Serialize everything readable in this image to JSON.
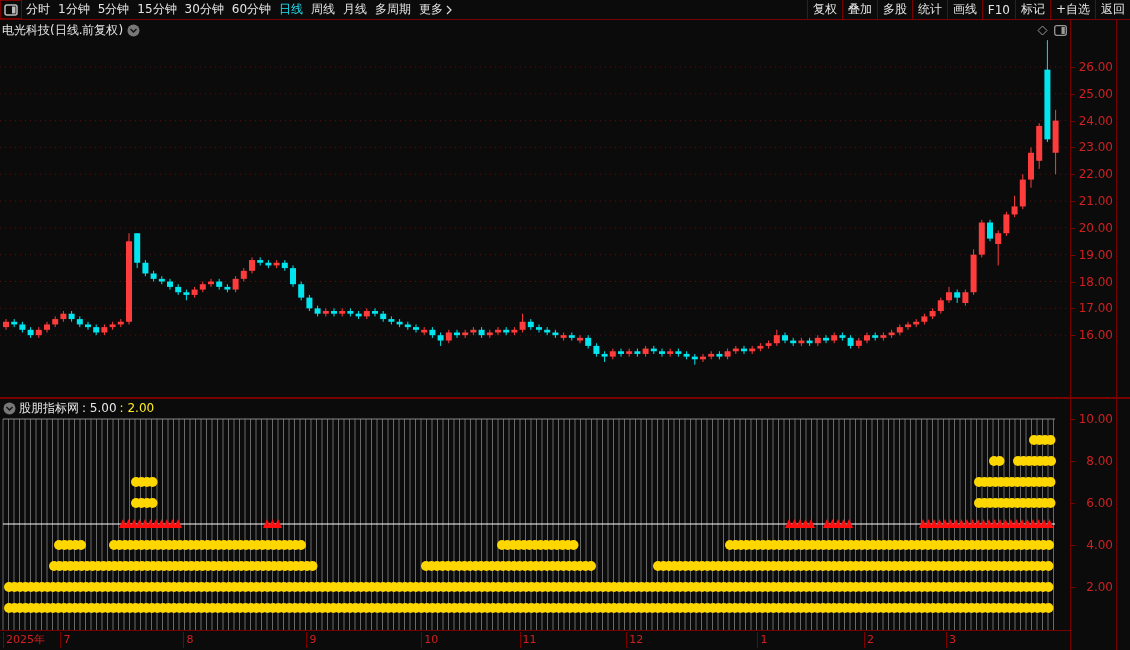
{
  "toolbar": {
    "periods": [
      {
        "label": "分时",
        "selected": false
      },
      {
        "label": "1分钟",
        "selected": false
      },
      {
        "label": "5分钟",
        "selected": false
      },
      {
        "label": "15分钟",
        "selected": false
      },
      {
        "label": "30分钟",
        "selected": false
      },
      {
        "label": "60分钟",
        "selected": false
      },
      {
        "label": "日线",
        "selected": true
      },
      {
        "label": "周线",
        "selected": false
      },
      {
        "label": "月线",
        "selected": false
      },
      {
        "label": "多周期",
        "selected": false
      },
      {
        "label": "更多",
        "selected": false
      }
    ],
    "buttons": [
      "复权",
      "叠加",
      "多股",
      "统计",
      "画线",
      "F10",
      "标记",
      "+自选",
      "返回"
    ]
  },
  "chart": {
    "title": "电光科技(日线.前复权)",
    "chart_data": {
      "type": "candlestick",
      "grid": true,
      "ylim": [
        4.3,
        27.75
      ],
      "yticks": [
        {
          "value": 26,
          "label": "26.00"
        },
        {
          "value": 25,
          "label": "25.00"
        },
        {
          "value": 24,
          "label": "24.00"
        },
        {
          "value": 23,
          "label": "23.00"
        },
        {
          "value": 22,
          "label": "22.00"
        },
        {
          "value": 21,
          "label": "21.00"
        },
        {
          "value": 20,
          "label": "20.00"
        },
        {
          "value": 19,
          "label": "19.00"
        },
        {
          "value": 18,
          "label": "18.00"
        },
        {
          "value": 17,
          "label": "17.00"
        },
        {
          "value": 16,
          "label": "16.00"
        }
      ],
      "ohlc": [
        [
          16.3,
          16.6,
          16.2,
          16.5
        ],
        [
          16.5,
          16.6,
          16.3,
          16.4
        ],
        [
          16.4,
          16.5,
          16.1,
          16.2
        ],
        [
          16.2,
          16.3,
          15.9,
          16.0
        ],
        [
          16.0,
          16.3,
          15.9,
          16.2
        ],
        [
          16.2,
          16.5,
          16.1,
          16.4
        ],
        [
          16.4,
          16.7,
          16.3,
          16.6
        ],
        [
          16.6,
          16.9,
          16.5,
          16.8
        ],
        [
          16.8,
          16.9,
          16.5,
          16.6
        ],
        [
          16.6,
          16.7,
          16.3,
          16.4
        ],
        [
          16.4,
          16.5,
          16.2,
          16.3
        ],
        [
          16.3,
          16.4,
          16.0,
          16.1
        ],
        [
          16.1,
          16.4,
          16.0,
          16.3
        ],
        [
          16.3,
          16.5,
          16.2,
          16.4
        ],
        [
          16.4,
          16.6,
          16.3,
          16.5
        ],
        [
          16.5,
          19.8,
          16.4,
          19.5
        ],
        [
          19.8,
          19.8,
          18.5,
          18.7
        ],
        [
          18.7,
          18.8,
          18.2,
          18.3
        ],
        [
          18.3,
          18.4,
          18.0,
          18.1
        ],
        [
          18.1,
          18.2,
          17.9,
          18.0
        ],
        [
          18.0,
          18.1,
          17.7,
          17.8
        ],
        [
          17.8,
          17.9,
          17.5,
          17.6
        ],
        [
          17.6,
          17.7,
          17.3,
          17.5
        ],
        [
          17.5,
          17.8,
          17.4,
          17.7
        ],
        [
          17.7,
          18.0,
          17.6,
          17.9
        ],
        [
          17.9,
          18.1,
          17.8,
          18.0
        ],
        [
          18.0,
          18.1,
          17.7,
          17.8
        ],
        [
          17.8,
          17.9,
          17.6,
          17.7
        ],
        [
          17.7,
          18.2,
          17.6,
          18.1
        ],
        [
          18.1,
          18.5,
          18.0,
          18.4
        ],
        [
          18.4,
          18.9,
          18.3,
          18.8
        ],
        [
          18.8,
          18.9,
          18.6,
          18.7
        ],
        [
          18.7,
          18.8,
          18.5,
          18.6
        ],
        [
          18.6,
          18.8,
          18.5,
          18.7
        ],
        [
          18.7,
          18.8,
          18.4,
          18.5
        ],
        [
          18.5,
          18.6,
          17.8,
          17.9
        ],
        [
          17.9,
          18.0,
          17.3,
          17.4
        ],
        [
          17.4,
          17.5,
          16.9,
          17.0
        ],
        [
          17.0,
          17.1,
          16.7,
          16.8
        ],
        [
          16.8,
          17.0,
          16.7,
          16.9
        ],
        [
          16.9,
          17.0,
          16.7,
          16.8
        ],
        [
          16.8,
          17.0,
          16.7,
          16.9
        ],
        [
          16.9,
          17.0,
          16.7,
          16.8
        ],
        [
          16.8,
          16.9,
          16.6,
          16.7
        ],
        [
          16.7,
          17.0,
          16.6,
          16.9
        ],
        [
          16.9,
          17.0,
          16.7,
          16.8
        ],
        [
          16.8,
          16.9,
          16.5,
          16.6
        ],
        [
          16.6,
          16.7,
          16.4,
          16.5
        ],
        [
          16.5,
          16.6,
          16.3,
          16.4
        ],
        [
          16.4,
          16.5,
          16.2,
          16.3
        ],
        [
          16.3,
          16.4,
          16.1,
          16.2
        ],
        [
          16.1,
          16.3,
          16.0,
          16.2
        ],
        [
          16.2,
          16.3,
          15.9,
          16.0
        ],
        [
          16.0,
          16.1,
          15.6,
          15.8
        ],
        [
          15.8,
          16.2,
          15.7,
          16.1
        ],
        [
          16.1,
          16.2,
          15.9,
          16.0
        ],
        [
          16.0,
          16.2,
          15.9,
          16.1
        ],
        [
          16.1,
          16.3,
          16.0,
          16.2
        ],
        [
          16.2,
          16.3,
          15.9,
          16.0
        ],
        [
          16.0,
          16.2,
          15.9,
          16.1
        ],
        [
          16.1,
          16.3,
          16.0,
          16.2
        ],
        [
          16.2,
          16.3,
          16.0,
          16.1
        ],
        [
          16.1,
          16.3,
          16.0,
          16.2
        ],
        [
          16.2,
          16.8,
          16.1,
          16.5
        ],
        [
          16.5,
          16.6,
          16.2,
          16.3
        ],
        [
          16.3,
          16.4,
          16.1,
          16.2
        ],
        [
          16.2,
          16.3,
          16.0,
          16.1
        ],
        [
          16.1,
          16.2,
          15.9,
          16.0
        ],
        [
          15.9,
          16.1,
          15.8,
          16.0
        ],
        [
          16.0,
          16.1,
          15.8,
          15.9
        ],
        [
          15.8,
          16.0,
          15.7,
          15.9
        ],
        [
          15.9,
          16.0,
          15.5,
          15.6
        ],
        [
          15.6,
          15.7,
          15.2,
          15.3
        ],
        [
          15.3,
          15.4,
          15.0,
          15.2
        ],
        [
          15.2,
          15.5,
          15.1,
          15.4
        ],
        [
          15.4,
          15.5,
          15.2,
          15.3
        ],
        [
          15.3,
          15.5,
          15.2,
          15.4
        ],
        [
          15.4,
          15.5,
          15.2,
          15.3
        ],
        [
          15.3,
          15.6,
          15.2,
          15.5
        ],
        [
          15.5,
          15.6,
          15.3,
          15.4
        ],
        [
          15.4,
          15.5,
          15.2,
          15.3
        ],
        [
          15.3,
          15.5,
          15.2,
          15.4
        ],
        [
          15.4,
          15.5,
          15.2,
          15.3
        ],
        [
          15.3,
          15.4,
          15.1,
          15.2
        ],
        [
          15.2,
          15.3,
          14.9,
          15.1
        ],
        [
          15.1,
          15.3,
          15.0,
          15.2
        ],
        [
          15.2,
          15.4,
          15.1,
          15.3
        ],
        [
          15.3,
          15.4,
          15.1,
          15.2
        ],
        [
          15.2,
          15.5,
          15.1,
          15.4
        ],
        [
          15.4,
          15.6,
          15.3,
          15.5
        ],
        [
          15.5,
          15.6,
          15.3,
          15.4
        ],
        [
          15.4,
          15.6,
          15.3,
          15.5
        ],
        [
          15.5,
          15.7,
          15.4,
          15.6
        ],
        [
          15.6,
          15.8,
          15.5,
          15.7
        ],
        [
          15.7,
          16.2,
          15.6,
          16.0
        ],
        [
          16.0,
          16.1,
          15.7,
          15.8
        ],
        [
          15.8,
          15.9,
          15.6,
          15.7
        ],
        [
          15.7,
          15.9,
          15.6,
          15.8
        ],
        [
          15.8,
          15.9,
          15.6,
          15.7
        ],
        [
          15.7,
          16.0,
          15.6,
          15.9
        ],
        [
          15.9,
          16.0,
          15.7,
          15.8
        ],
        [
          15.8,
          16.1,
          15.7,
          16.0
        ],
        [
          16.0,
          16.1,
          15.8,
          15.9
        ],
        [
          15.9,
          16.0,
          15.5,
          15.6
        ],
        [
          15.6,
          15.9,
          15.5,
          15.8
        ],
        [
          15.8,
          16.1,
          15.7,
          16.0
        ],
        [
          16.0,
          16.1,
          15.8,
          15.9
        ],
        [
          15.9,
          16.1,
          15.8,
          16.0
        ],
        [
          16.0,
          16.2,
          15.9,
          16.1
        ],
        [
          16.1,
          16.4,
          16.0,
          16.3
        ],
        [
          16.3,
          16.5,
          16.2,
          16.4
        ],
        [
          16.4,
          16.6,
          16.3,
          16.5
        ],
        [
          16.5,
          16.8,
          16.4,
          16.7
        ],
        [
          16.7,
          17.0,
          16.6,
          16.9
        ],
        [
          16.9,
          17.4,
          16.8,
          17.3
        ],
        [
          17.3,
          17.8,
          17.2,
          17.6
        ],
        [
          17.6,
          17.7,
          17.2,
          17.4
        ],
        [
          17.2,
          17.7,
          17.1,
          17.6
        ],
        [
          17.6,
          19.2,
          17.5,
          19.0
        ],
        [
          19.0,
          20.3,
          18.9,
          20.2
        ],
        [
          20.2,
          20.3,
          19.5,
          19.6
        ],
        [
          19.4,
          19.9,
          18.6,
          19.8
        ],
        [
          19.8,
          20.6,
          19.7,
          20.5
        ],
        [
          20.5,
          21.2,
          20.4,
          20.8
        ],
        [
          20.8,
          22.0,
          20.7,
          21.8
        ],
        [
          21.8,
          23.0,
          21.5,
          22.8
        ],
        [
          22.5,
          23.9,
          22.2,
          23.8
        ],
        [
          25.9,
          27.0,
          23.2,
          23.3
        ],
        [
          22.8,
          24.4,
          22.0,
          24.0
        ]
      ]
    }
  },
  "date_axis": [
    "2025年",
    "7",
    "8",
    "9",
    "10",
    "11",
    "12",
    "1",
    "2",
    "3"
  ],
  "indicator": {
    "name": "股朋指标网",
    "value_1": ": 5.00",
    "value_2": ": 2.00",
    "axis": [
      "10.00",
      "8.00",
      "6.00",
      "4.00",
      "2.00"
    ]
  }
}
